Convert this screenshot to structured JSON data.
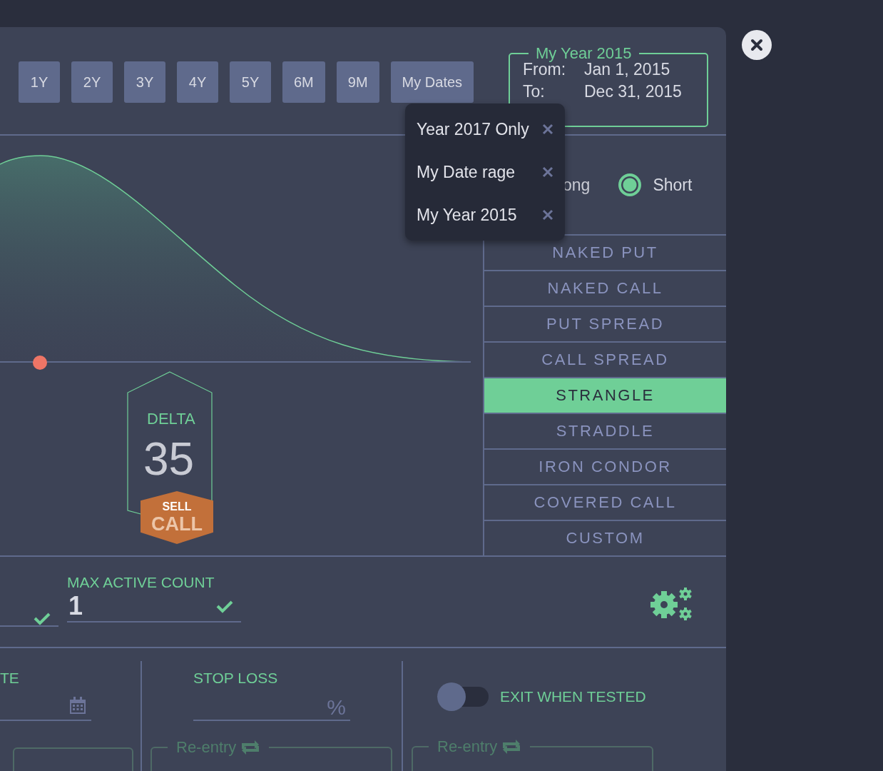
{
  "range_buttons": [
    {
      "label": "1Y"
    },
    {
      "label": "2Y"
    },
    {
      "label": "3Y"
    },
    {
      "label": "4Y"
    },
    {
      "label": "5Y"
    },
    {
      "label": "6M"
    },
    {
      "label": "9M"
    },
    {
      "label": "My Dates"
    }
  ],
  "date_range": {
    "legend": "My Year 2015",
    "from_label": "From:",
    "from_value": "Jan 1, 2015",
    "to_label": "To:",
    "to_value": "Dec 31, 2015"
  },
  "saved_dates_menu": [
    {
      "label": "Year 2017 Only"
    },
    {
      "label": "My Date rage"
    },
    {
      "label": "My Year 2015"
    }
  ],
  "direction": {
    "partial_label": "ong",
    "short": {
      "label": "Short",
      "selected": true
    }
  },
  "strategies": [
    {
      "label": "NAKED PUT",
      "selected": false
    },
    {
      "label": "NAKED CALL",
      "selected": false
    },
    {
      "label": "PUT SPREAD",
      "selected": false
    },
    {
      "label": "CALL SPREAD",
      "selected": false
    },
    {
      "label": "STRANGLE",
      "selected": true
    },
    {
      "label": "STRADDLE",
      "selected": false
    },
    {
      "label": "IRON CONDOR",
      "selected": false
    },
    {
      "label": "COVERED CALL",
      "selected": false
    },
    {
      "label": "CUSTOM",
      "selected": false
    }
  ],
  "delta_badge": {
    "label": "DELTA",
    "value": "35",
    "action": "SELL",
    "option": "CALL"
  },
  "max_active_count": {
    "label": "MAX ACTIVE COUNT",
    "value": "1"
  },
  "date_column": {
    "partial_label": "TE"
  },
  "stop_loss": {
    "label": "STOP LOSS",
    "unit": "%",
    "reentry": "Re-entry"
  },
  "exit_when_tested": {
    "label": "EXIT WHEN TESTED",
    "on": false,
    "reentry": "Re-entry"
  }
}
